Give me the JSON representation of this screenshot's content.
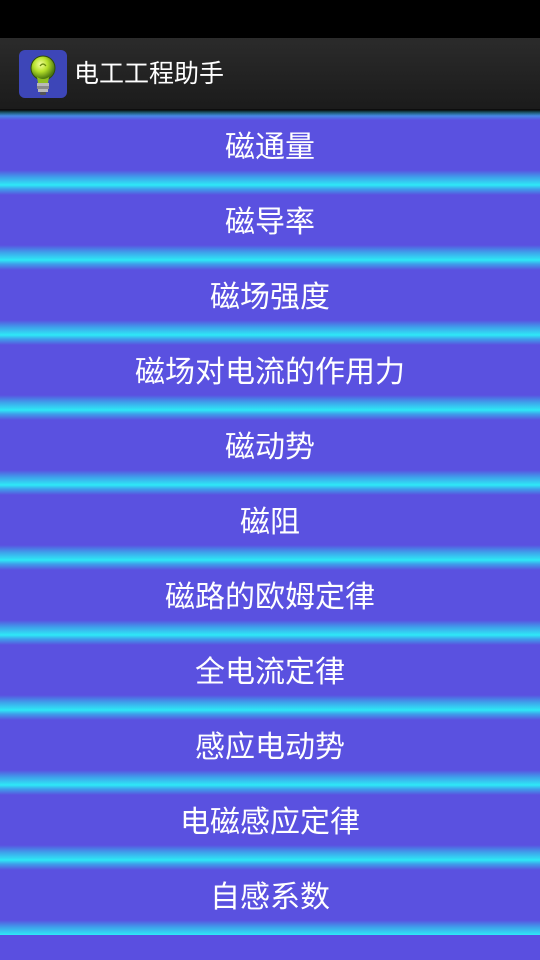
{
  "app": {
    "title": "电工工程助手",
    "icon": "lightbulb-icon"
  },
  "colors": {
    "list_background": "#5a51e0",
    "separator_glow": "#2ee8f6",
    "text": "#ffffff"
  },
  "items": [
    {
      "label": "磁通量"
    },
    {
      "label": "磁导率"
    },
    {
      "label": "磁场强度"
    },
    {
      "label": "磁场对电流的作用力"
    },
    {
      "label": "磁动势"
    },
    {
      "label": "磁阻"
    },
    {
      "label": "磁路的欧姆定律"
    },
    {
      "label": "全电流定律"
    },
    {
      "label": "感应电动势"
    },
    {
      "label": "电磁感应定律"
    },
    {
      "label": "自感系数"
    }
  ]
}
